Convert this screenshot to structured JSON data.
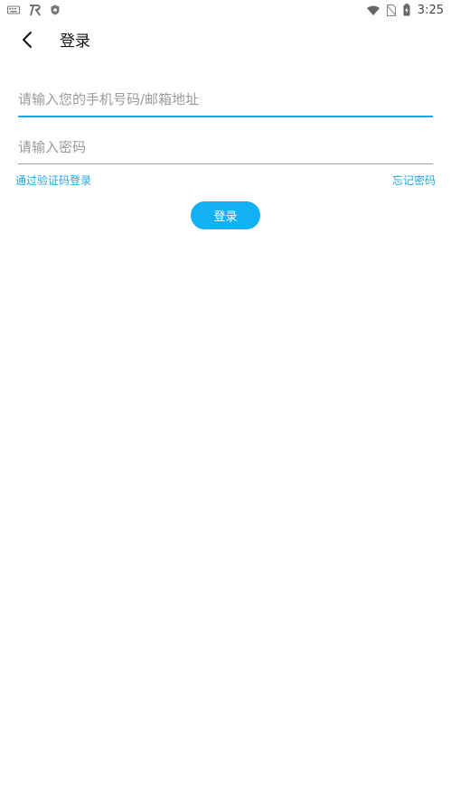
{
  "status_bar": {
    "time": "3:25",
    "icons": [
      "keyboard-icon",
      "app-r-icon",
      "shield-icon",
      "wifi-icon",
      "no-sim-icon",
      "battery-charging-icon"
    ]
  },
  "header": {
    "back_icon": "chevron-left-icon",
    "title": "登录"
  },
  "form": {
    "account_placeholder": "请输入您的手机号码/邮箱地址",
    "account_value": "",
    "password_placeholder": "请输入密码",
    "password_value": "",
    "code_login_link": "通过验证码登录",
    "forgot_password_link": "忘记密码",
    "login_button": "登录"
  },
  "colors": {
    "accent": "#1ea7e8",
    "button": "#12b0f5",
    "underline": "#9e9e9e"
  }
}
